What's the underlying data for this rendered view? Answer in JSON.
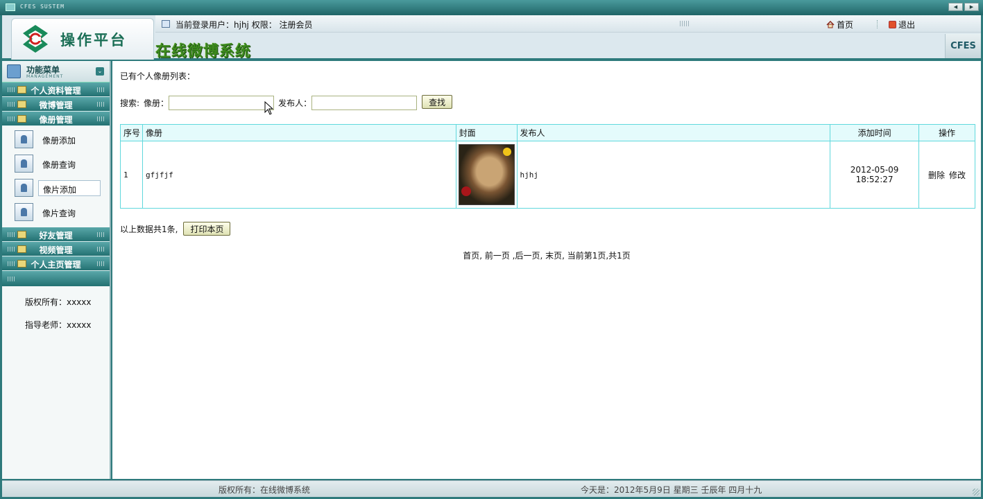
{
  "window": {
    "title": "CFES SUSTEM"
  },
  "header": {
    "platform_name": "操作平台",
    "system_title": "在线微博系统",
    "user_info": "当前登录用户：hjhj 权限： 注册会员",
    "home_label": "首页",
    "exit_label": "退出",
    "badge": "CFES"
  },
  "sidebar": {
    "menu_title": "功能菜单",
    "menu_subtitle": "MANAGEMENT",
    "categories": [
      {
        "label": "个人资料管理"
      },
      {
        "label": "微博管理"
      },
      {
        "label": "像册管理"
      }
    ],
    "subitems": [
      {
        "label": "像册添加"
      },
      {
        "label": "像册查询"
      },
      {
        "label": "像片添加"
      },
      {
        "label": "像片查询"
      }
    ],
    "categories_after": [
      {
        "label": "好友管理"
      },
      {
        "label": "视频管理"
      },
      {
        "label": "个人主页管理"
      }
    ],
    "copyright": "版权所有：xxxxx",
    "advisor": "指导老师：xxxxx"
  },
  "main": {
    "list_title": "已有个人像册列表：",
    "search": {
      "label": "搜索:",
      "album_label": "像册：",
      "album_value": "",
      "publisher_label": "发布人：",
      "publisher_value": "",
      "button_label": "查找"
    },
    "table": {
      "headers": [
        "序号",
        "像册",
        "封面",
        "发布人",
        "添加时间",
        "操作"
      ],
      "rows": [
        {
          "index": "1",
          "album": "gfjfjf",
          "publisher": "hjhj",
          "added_time": "2012-05-09 18:52:27",
          "delete_label": "删除",
          "edit_label": "修改"
        }
      ]
    },
    "count_text": "以上数据共1条,",
    "print_button": "打印本页",
    "pager_text": "首页, 前一页 ,后一页, 末页, 当前第1页,共1页"
  },
  "footer": {
    "copyright": "版权所有：在线微博系统",
    "today": "今天是：2012年5月9日 星期三 壬辰年 四月十九"
  },
  "colors": {
    "frame_teal": "#2e7a7c",
    "table_border": "#60d8dc",
    "table_header_bg": "#e4fbfc",
    "title_green": "#3d8a1e"
  }
}
